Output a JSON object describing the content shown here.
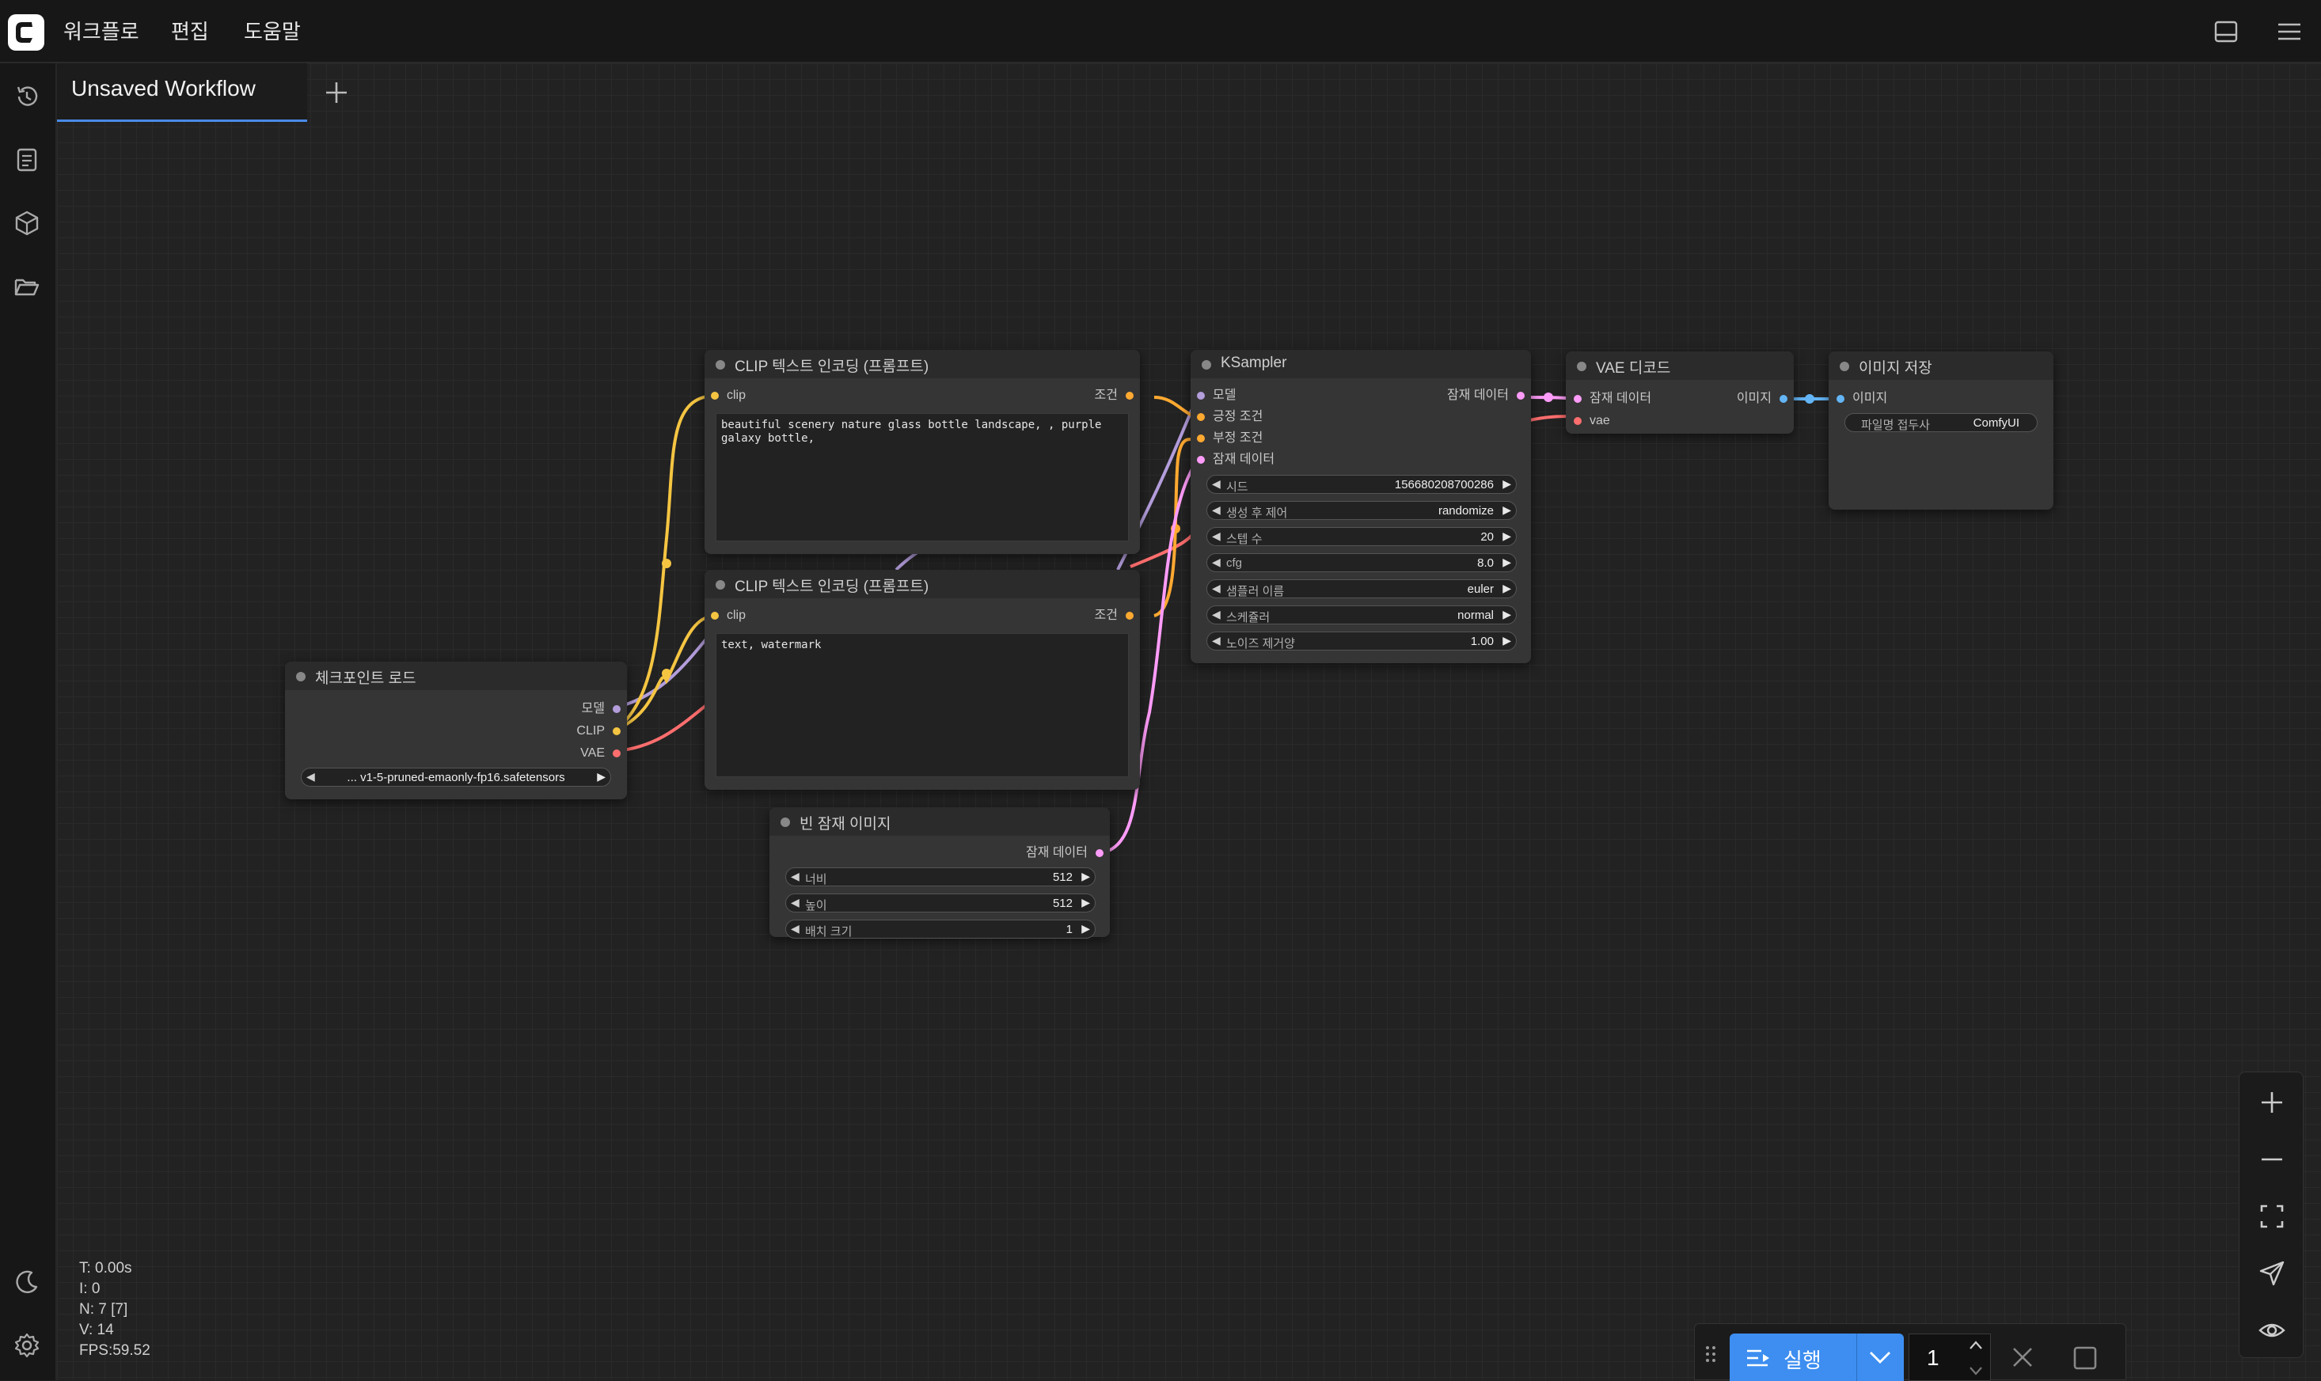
{
  "menu": {
    "workflow": "워크플로",
    "edit": "편집",
    "help": "도움말"
  },
  "tab": {
    "title": "Unsaved Workflow"
  },
  "nodes": {
    "clip_pos": {
      "title": "CLIP 텍스트 인코딩 (프롬프트)",
      "input_clip": "clip",
      "output": "조건",
      "text": "beautiful scenery nature glass bottle landscape, , purple galaxy bottle,"
    },
    "clip_neg": {
      "title": "CLIP 텍스트 인코딩 (프롬프트)",
      "input_clip": "clip",
      "output": "조건",
      "text": "text, watermark"
    },
    "checkpoint": {
      "title": "체크포인트 로드",
      "out_model": "모델",
      "out_clip": "CLIP",
      "out_vae": "VAE",
      "ckpt": "... v1-5-pruned-emaonly-fp16.safetensors"
    },
    "ksampler": {
      "title": "KSampler",
      "in_model": "모델",
      "in_positive": "긍정 조건",
      "in_negative": "부정 조건",
      "in_latent": "잠재 데이터",
      "out_latent": "잠재 데이터",
      "widgets": [
        {
          "label": "시드",
          "value": "156680208700286"
        },
        {
          "label": "생성 후 제어",
          "value": "randomize"
        },
        {
          "label": "스텝 수",
          "value": "20"
        },
        {
          "label": "cfg",
          "value": "8.0"
        },
        {
          "label": "샘플러 이름",
          "value": "euler"
        },
        {
          "label": "스케쥴러",
          "value": "normal"
        },
        {
          "label": "노이즈 제거양",
          "value": "1.00"
        }
      ]
    },
    "vae_decode": {
      "title": "VAE 디코드",
      "in_latent": "잠재 데이터",
      "in_vae": "vae",
      "out_image": "이미지"
    },
    "save_image": {
      "title": "이미지 저장",
      "in_image": "이미지",
      "prefix_label": "파일명 접두사",
      "prefix_value": "ComfyUI"
    },
    "empty_latent": {
      "title": "빈 잠재 이미지",
      "out_latent": "잠재 데이터",
      "widgets": [
        {
          "label": "너비",
          "value": "512"
        },
        {
          "label": "높이",
          "value": "512"
        },
        {
          "label": "배치 크기",
          "value": "1"
        }
      ]
    }
  },
  "stats": {
    "t": "T: 0.00s",
    "i": "I: 0",
    "n": "N: 7 [7]",
    "v": "V: 14",
    "fps": "FPS:59.52"
  },
  "run": {
    "label": "실행",
    "count": "1"
  },
  "colors": {
    "clip": "#f5c542",
    "model": "#b39ddb",
    "vae": "#ff6e6e",
    "latent": "#ff9cf9",
    "image": "#64b5f6",
    "conditioning": "#ffa931",
    "accent": "#3d8ef0"
  }
}
